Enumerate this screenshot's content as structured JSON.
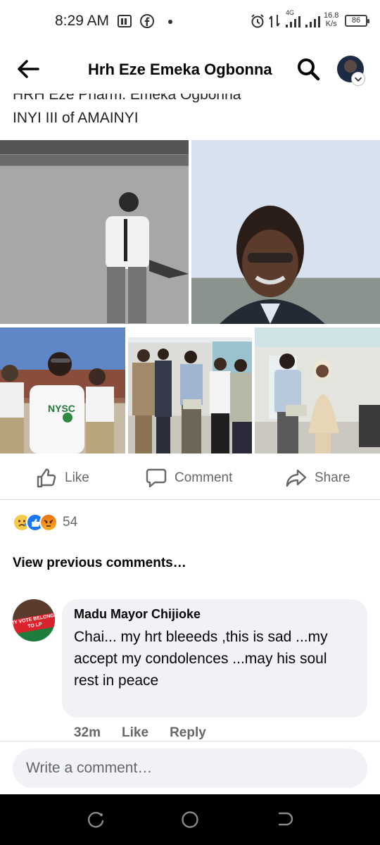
{
  "status_bar": {
    "time": "8:29 AM",
    "network_label": "4G",
    "speed_value": "16.8",
    "speed_unit": "K/s",
    "battery": "86",
    "icons": [
      "notification-icon",
      "facebook-icon",
      "dot-icon",
      "alarm-icon",
      "data-arrows-icon",
      "signal-icon",
      "signal-icon-2",
      "battery-icon"
    ]
  },
  "header": {
    "title": "Hrh Eze Emeka Ogbonna",
    "icons": [
      "back-arrow-icon",
      "search-icon",
      "profile-avatar",
      "chevron-down-icon"
    ]
  },
  "post": {
    "text_line_1": "HRH Eze Pharm. Emeka Ogbonna",
    "text_line_2": "INYI III of AMAINYI",
    "photo_texts": [
      "NYSC"
    ]
  },
  "actions": {
    "like": "Like",
    "comment": "Comment",
    "share": "Share"
  },
  "reactions": {
    "types": [
      "sad",
      "like",
      "angry"
    ],
    "count": "54"
  },
  "view_previous": "View previous comments…",
  "comment": {
    "author": "Madu Mayor Chijioke",
    "text": "Chai... my hrt bleeeds ,this is sad ...my accept my condolences ...may his soul rest in peace",
    "avatar_text": "MY VOTE BELONGS TO LP",
    "time": "32m",
    "like": "Like",
    "reply": "Reply"
  },
  "composer": {
    "placeholder": "Write a comment…"
  },
  "navbar": {
    "icons": [
      "recent-apps-icon",
      "home-icon",
      "back-icon"
    ]
  },
  "colors": {
    "facebook_blue": "#1877f2",
    "secondary_text": "#65676b",
    "bubble_bg": "#f0f2f5"
  }
}
